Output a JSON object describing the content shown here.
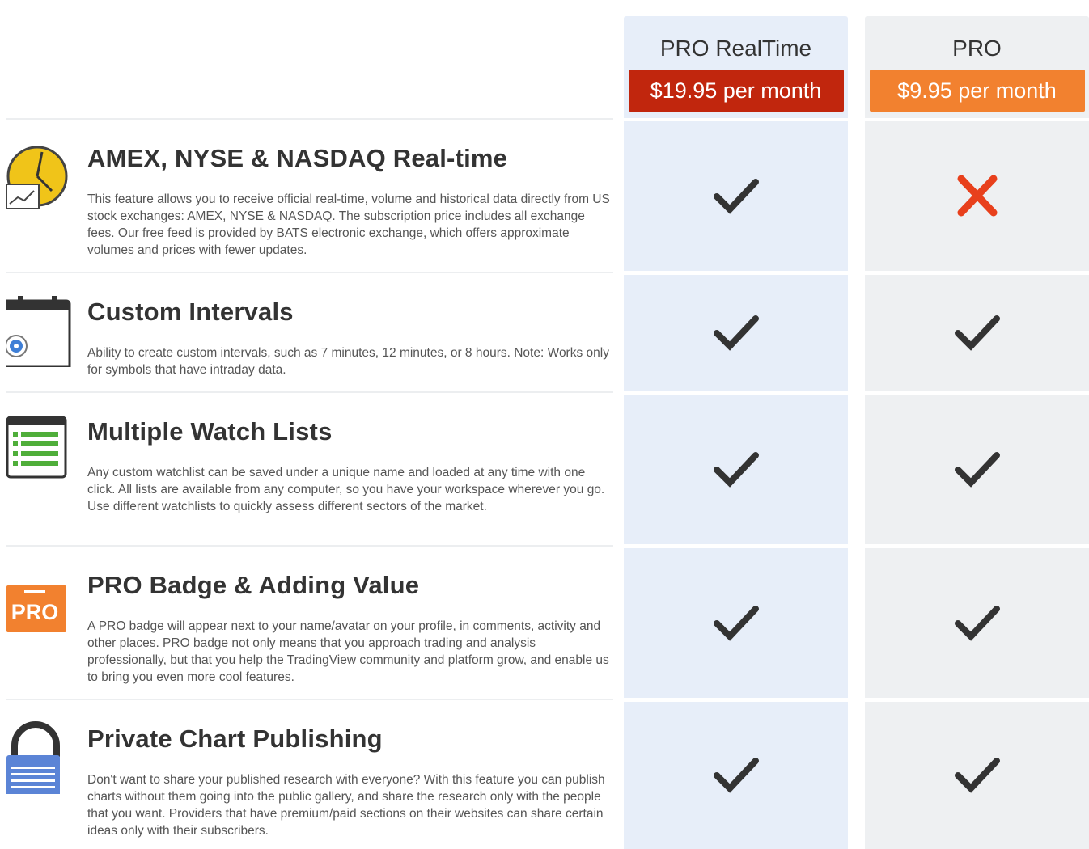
{
  "plans": [
    {
      "name": "PRO RealTime",
      "price": "$19.95 per month"
    },
    {
      "name": "PRO",
      "price": "$9.95 per month"
    }
  ],
  "features": [
    {
      "icon": "realtime-clock-icon",
      "title": "AMEX, NYSE & NASDAQ Real-time",
      "description": "This feature allows you to receive official real-time, volume and historical data directly from US stock exchanges: AMEX, NYSE & NASDAQ. The subscription price includes all exchange fees. Our free feed is provided by BATS electronic exchange, which offers approximate volumes and prices with fewer updates.",
      "pro_realtime": true,
      "pro": false
    },
    {
      "icon": "calendar-gear-icon",
      "title": "Custom Intervals",
      "description": "Ability to create custom intervals, such as 7 minutes, 12 minutes, or 8 hours. Note: Works only for symbols that have intraday data.",
      "pro_realtime": true,
      "pro": true
    },
    {
      "icon": "list-icon",
      "title": "Multiple Watch Lists",
      "description": "Any custom watchlist can be saved under a unique name and loaded at any time with one click. All lists are available from any computer, so you have your workspace wherever you go. Use different watchlists to quickly assess different sectors of the market.",
      "pro_realtime": true,
      "pro": true
    },
    {
      "icon": "pro-badge-icon",
      "icon_text": "PRO",
      "title": "PRO Badge & Adding Value",
      "description": "A PRO badge will appear next to your name/avatar on your profile, in comments, activity and other places. PRO badge not only means that you approach trading and analysis professionally, but that you help the TradingView community and platform grow, and enable us to bring you even more cool features.",
      "pro_realtime": true,
      "pro": true
    },
    {
      "icon": "padlock-icon",
      "title": "Private Chart Publishing",
      "description": "Don't want to share your published research with everyone? With this feature you can publish charts without them going into the public gallery, and share the research only with the people that you want. Providers that have premium/paid sections on their websites can share certain ideas only with their subscribers.",
      "pro_realtime": true,
      "pro": true
    }
  ],
  "colors": {
    "realtime_price_bg": "#c1260d",
    "pro_price_bg": "#f2812f",
    "check": "#333333",
    "cross": "#e8401c"
  }
}
